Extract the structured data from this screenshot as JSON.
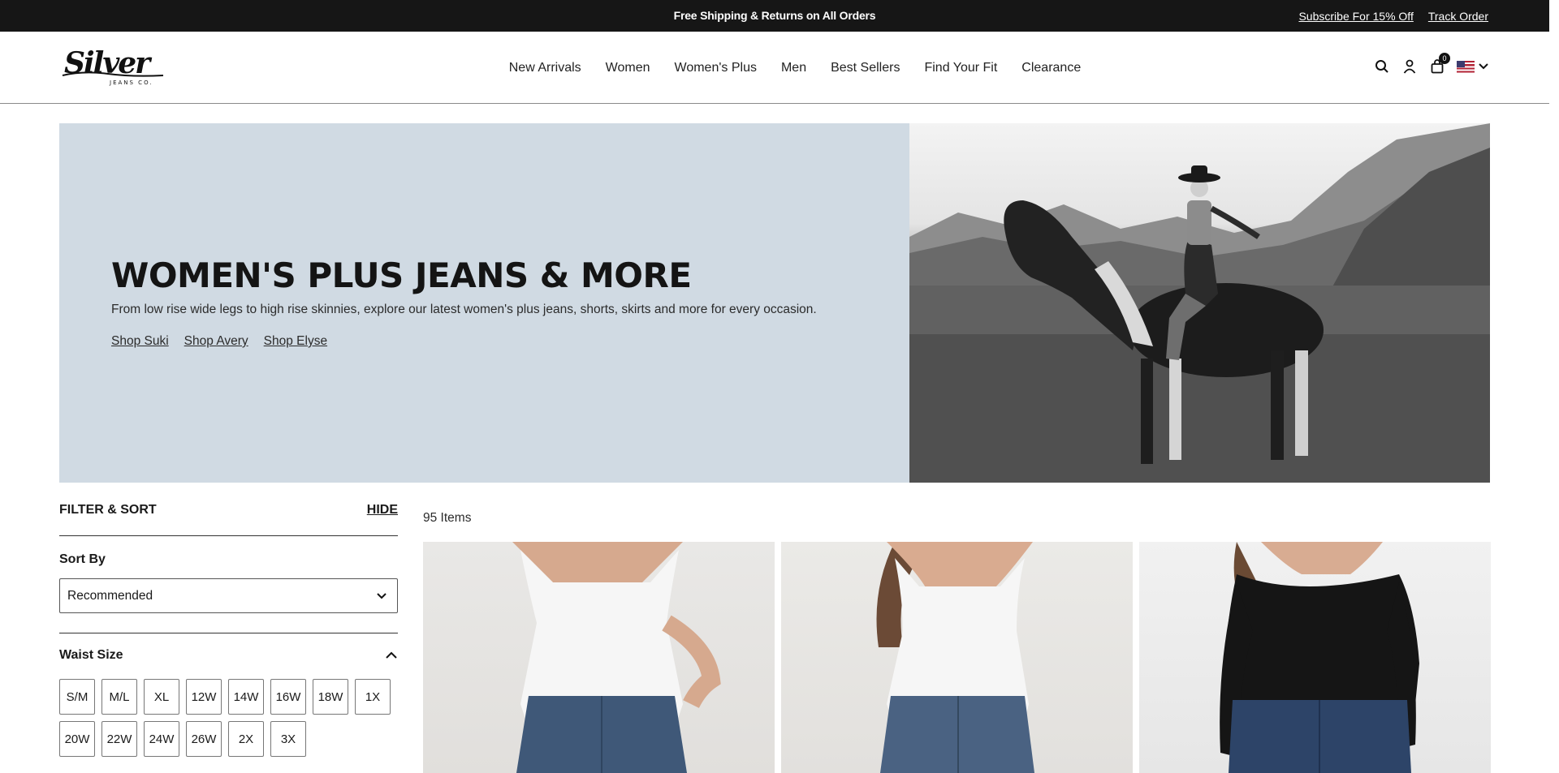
{
  "announcement": {
    "promo": "Free Shipping & Returns on All Orders",
    "subscribe": "Subscribe For 15% Off",
    "track": "Track Order"
  },
  "header": {
    "logo_text": "Silver",
    "logo_sub": "JEANS CO.",
    "nav": [
      "New Arrivals",
      "Women",
      "Women's Plus",
      "Men",
      "Best Sellers",
      "Find Your Fit",
      "Clearance"
    ],
    "icons": [
      "search-icon",
      "account-icon",
      "cart-icon",
      "us-flag-icon",
      "chevron-down-icon"
    ],
    "cart_count": "0"
  },
  "hero": {
    "title": "WOMEN'S PLUS JEANS & MORE",
    "subtitle": "From low rise wide legs to high rise skinnies, explore our latest women's plus jeans, shorts, skirts and more for every occasion.",
    "links": [
      "Shop Suki",
      "Shop Avery",
      "Shop Elyse"
    ],
    "bg_color": "#d0dae3"
  },
  "filter": {
    "heading": "FILTER & SORT",
    "hide": "HIDE",
    "sort_label": "Sort By",
    "sort_value": "Recommended",
    "waist_label": "Waist Size",
    "sizes": [
      "S/M",
      "M/L",
      "XL",
      "12W",
      "14W",
      "16W",
      "18W",
      "1X",
      "20W",
      "22W",
      "24W",
      "26W",
      "2X",
      "3X"
    ]
  },
  "products": {
    "count": "95 Items"
  }
}
